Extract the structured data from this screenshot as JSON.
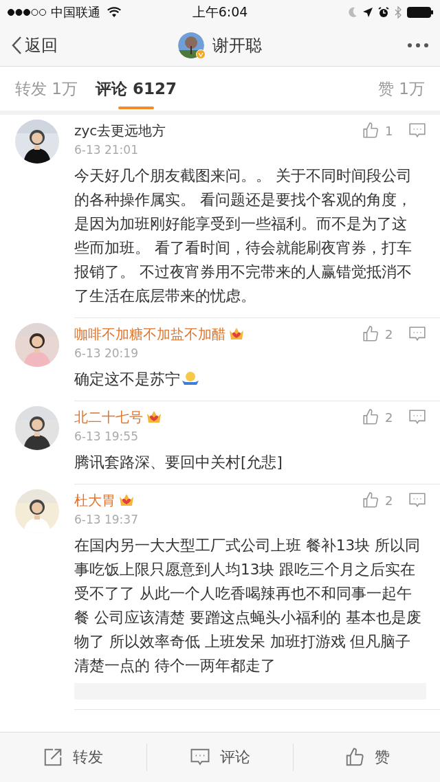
{
  "status_bar": {
    "carrier": "中国联通",
    "time": "上午6:04"
  },
  "nav": {
    "back": "返回",
    "title": "谢开聪",
    "verified": true
  },
  "tabs": [
    {
      "label": "转发 1万",
      "selected": false
    },
    {
      "label": "评论 6127",
      "selected": true
    },
    {
      "label": "赞 1万",
      "selected": false
    }
  ],
  "comments": [
    {
      "name": "zyc去更远地方",
      "vip": false,
      "date": "6-13 21:01",
      "likes": "1",
      "text": "今天好几个朋友截图来问。。 关于不同时间段公司的各种操作属实。 看问题还是要找个客观的角度，是因为加班刚好能享受到一些福利。而不是为了这些而加班。 看了看时间，待会就能刷夜宵券，打车报销了。 不过夜宵券用不完带来的人赢错觉抵消不了生活在底层带来的忧虑。",
      "emoji": false
    },
    {
      "name": "咖啡不加糖不加盐不加醋",
      "vip": true,
      "date": "6-13 20:19",
      "likes": "2",
      "text": "确定这不是苏宁",
      "emoji": true
    },
    {
      "name": "北二十七号",
      "vip": true,
      "date": "6-13 19:55",
      "likes": "2",
      "text": "腾讯套路深、要回中关村[允悲]",
      "emoji": false
    },
    {
      "name": "杜大胃",
      "vip": true,
      "date": "6-13 19:37",
      "likes": "2",
      "text": "在国内另一大大型工厂式公司上班 餐补13块 所以同事吃饭上限只愿意到人均13块 跟吃三个月之后实在受不了了 从此一个人吃香喝辣再也不和同事一起午餐 公司应该清楚 要蹭这点蝇头小福利的 基本也是废物了 所以效率奇低 上班发呆 加班打游戏 但凡脑子清楚一点的 待个一两年都走了",
      "emoji": false
    }
  ],
  "bottom_bar": [
    {
      "kind": "share",
      "label": "转发"
    },
    {
      "kind": "comment",
      "label": "评论"
    },
    {
      "kind": "like",
      "label": "赞"
    }
  ]
}
